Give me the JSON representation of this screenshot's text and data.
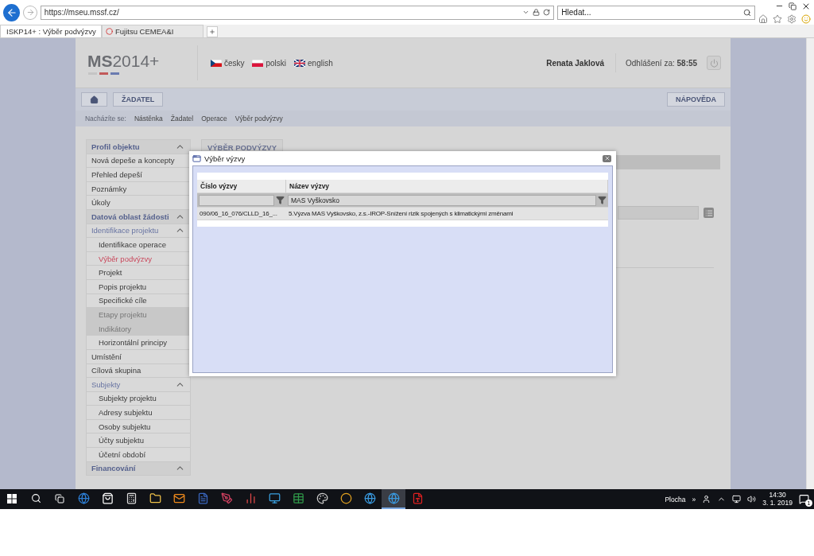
{
  "browser": {
    "address": "https://mseu.mssf.cz/",
    "search_placeholder": "Hledat...",
    "tabs": [
      {
        "label": "ISKP14+ : Výběr podvýzvy",
        "selected": true
      },
      {
        "label": "Fujitsu CEMEA&I",
        "selected": false
      }
    ]
  },
  "header": {
    "logo_bold": "MS",
    "logo_rest": "2014+",
    "languages": [
      {
        "kind": "cz",
        "label": "česky"
      },
      {
        "kind": "pl",
        "label": "polski"
      },
      {
        "kind": "en",
        "label": "english"
      }
    ],
    "user": "Renata Jaklová",
    "logout_label": "Odhlášení za:",
    "logout_time": "58:55"
  },
  "nav": {
    "buttons": [
      "ŽADATEL"
    ],
    "help": "NÁPOVĚDA"
  },
  "breadcrumb": {
    "label": "Nacházíte se:",
    "items": [
      "Nástěnka",
      "Žadatel",
      "Operace",
      "Výběr podvýzvy"
    ]
  },
  "sidebar": [
    {
      "label": "Profil objektu",
      "expanded": true,
      "children": [
        {
          "label": "Nová depeše a koncepty",
          "selected": false,
          "disabled": false
        },
        {
          "label": "Přehled depeší",
          "selected": false,
          "disabled": false
        },
        {
          "label": "Poznámky",
          "selected": false,
          "disabled": false
        },
        {
          "label": "Úkoly",
          "selected": false,
          "disabled": false
        }
      ]
    },
    {
      "label": "Datová oblast žádosti",
      "expanded": true,
      "children": [
        {
          "label": "Identifikace projektu",
          "expanded": true,
          "children": [
            {
              "label": "Identifikace operace",
              "selected": false,
              "disabled": false
            },
            {
              "label": "Výběr podvýzvy",
              "selected": true,
              "disabled": false
            },
            {
              "label": "Projekt",
              "selected": false,
              "disabled": false
            },
            {
              "label": "Popis projektu",
              "selected": false,
              "disabled": false
            },
            {
              "label": "Specifické cíle",
              "selected": false,
              "disabled": false
            },
            {
              "label": "Etapy projektu",
              "selected": false,
              "disabled": true
            },
            {
              "label": "Indikátory",
              "selected": false,
              "disabled": true
            },
            {
              "label": "Horizontální principy",
              "selected": false,
              "disabled": false
            }
          ]
        },
        {
          "label": "Umístění",
          "selected": false,
          "disabled": false
        },
        {
          "label": "Cílová skupina",
          "selected": false,
          "disabled": false
        },
        {
          "label": "Subjekty",
          "expanded": true,
          "children": [
            {
              "label": "Subjekty projektu",
              "selected": false,
              "disabled": false
            },
            {
              "label": "Adresy subjektu",
              "selected": false,
              "disabled": false
            },
            {
              "label": "Osoby subjektu",
              "selected": false,
              "disabled": false
            },
            {
              "label": "Účty subjektu",
              "selected": false,
              "disabled": false
            },
            {
              "label": "Účetní období",
              "selected": false,
              "disabled": false
            }
          ]
        }
      ]
    },
    {
      "label": "Financování",
      "expanded": true
    }
  ],
  "main": {
    "tab": "VÝBĚR PODVÝZVY"
  },
  "dialog": {
    "title": "Výběr výzvy",
    "columns": [
      {
        "label": "Číslo výzvy"
      },
      {
        "label": "Název výzvy",
        "filter": "MAS Vyškovsko"
      }
    ],
    "rows": [
      {
        "cells": [
          "090/06_16_076/CLLD_16_...",
          "5.Výzva MAS Vyškovsko, z.s.-IROP-Snížení rizik spojených s klimatickými změnami"
        ]
      }
    ]
  },
  "taskbar": {
    "apps": [
      {
        "kind": "edge",
        "selected": false
      },
      {
        "kind": "store",
        "selected": false
      },
      {
        "kind": "calculator",
        "selected": false
      },
      {
        "kind": "folder",
        "selected": false
      },
      {
        "kind": "mail",
        "selected": false
      },
      {
        "kind": "word",
        "selected": false
      },
      {
        "kind": "paint",
        "selected": false
      },
      {
        "kind": "chart",
        "selected": false
      },
      {
        "kind": "monitor",
        "selected": false
      },
      {
        "kind": "sheet",
        "selected": false
      },
      {
        "kind": "palette",
        "selected": false
      },
      {
        "kind": "chrome",
        "selected": false
      },
      {
        "kind": "ie",
        "selected": false
      },
      {
        "kind": "ie",
        "selected": true
      },
      {
        "kind": "pdf",
        "selected": false
      }
    ],
    "desktop_label": "Plocha",
    "overflow": "»",
    "time": "14:30",
    "date": "3. 1. 2019",
    "notifications": "1"
  }
}
